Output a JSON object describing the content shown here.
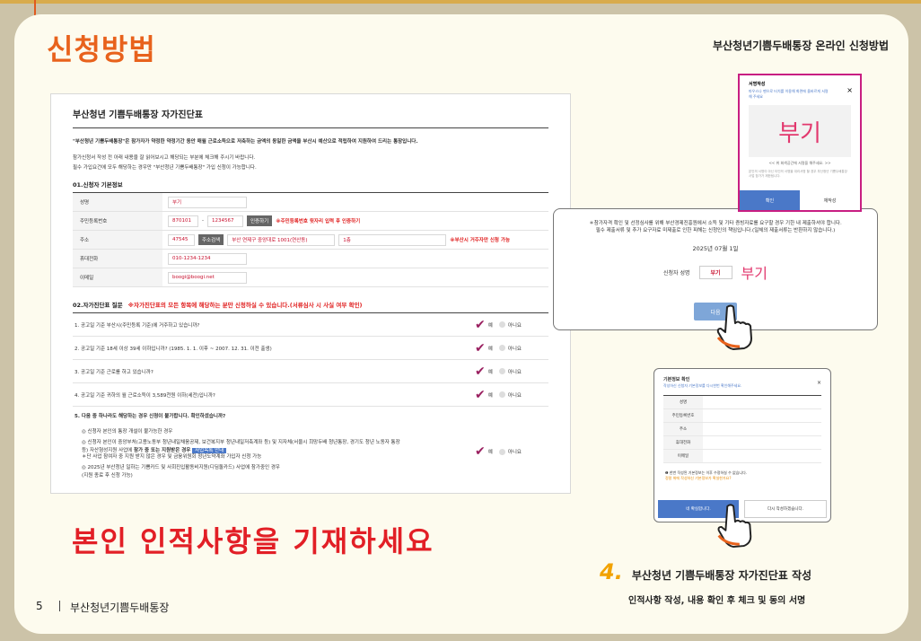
{
  "header": {
    "title": "신청방법",
    "subtitle": "부산청년기쁨두배통장 온라인 신청방법"
  },
  "form": {
    "title": "부산청년 기쁨두배통장 자가진단표",
    "intro_bold": "\"부산청년 기쁨두배통장\"은 참가자가 약정한 약정기간 동안 매월 근로소득으로 저축하는 금액의 동일한 금액을 부산시 예산으로 적립하여 지원하여 드리는 통장입니다.",
    "intro_line1": "참가신청서 작성 전 아래 내용을 잘 읽어보시고 해당되는 부분에 체크해 주시기 바랍니다.",
    "intro_line2": "필수 가입요건에 모두 해당하는 경우만 \"부산청년 기쁨두배통장\" 가입 신청이 가능합니다.",
    "section1": "01.신청자 기본정보",
    "fields": {
      "name_label": "성명",
      "name_value": "부기",
      "rrn_label": "주민등록번호",
      "rrn_front": "870101",
      "rrn_dash": "-",
      "rrn_back": "1234567",
      "verify_btn": "인증하기",
      "rrn_note": "※주민등록번호 뒷자리 입력 후 인증하기",
      "addr_label": "주소",
      "zip": "47545",
      "zip_btn": "주소검색",
      "addr_value": "부산 연제구 중앙대로 1001(연산동)",
      "addr_detail": "1층",
      "addr_note": "※부산시 거주자만 신청 가능",
      "phone_label": "휴대전화",
      "phone_value": "010-1234-1234",
      "email_label": "이메일",
      "email_value": "boogi@boogi.net"
    },
    "section2": "02.자가진단표 질문",
    "section2_note": "※자가진단표의 모든 항목에 해당하는 분만 신청하실 수 있습니다.(서류심사 시 사실 여부 확인)",
    "yes": "예",
    "no": "아니요",
    "questions": [
      "1. 공고일 기준 부산시(주민등록 기준)에 거주하고 있습니까?",
      "2. 공고일 기준 18세 이상 39세 이하입니까? (1985. 1. 1. 이후 ~ 2007. 12. 31. 이전 출생)",
      "3. 공고일 기준 근로를 하고 있습니까?",
      "4. 공고일 기준 귀하의 월 근로소득이 3,589천원 이하(세전)입니까?"
    ],
    "q5": {
      "title": "5. 다음 중 하나라도 해당하는 경우 신청이 불가합니다. 확인하셨습니까?",
      "item1": "◎ 신청자 본인의 통장 개설이 불가능한 경우",
      "item2a": "◎ 신청자 본인이 중앙부처(고용노동부 청년내일채움공제, 보건복지부 청년내일저축계좌 등) 및 지자체(서울시 희망두배 청년통장, 경기도 청년 노동자 통장",
      "item2b_pre": "등) 자산형성지원 사업에",
      "item2b_bold": "참가 중 또는 지원받은 경우",
      "item2b_badge": "사업목록 안내",
      "item2c": "＊단 사업 참여자 중 지원 받지 않은 경우 및 금융위원회 청년도약계좌 가입자 신청 가능",
      "item3a": "◎ 2025년 부산청년 일하는 기쁨카드 및 사회진입활동비지원(디딤돌카드) 사업에 참가중인 경우",
      "item3b": "(지원 종료 후 신청 가능)"
    }
  },
  "caption": "본인 인적사항을 기재하세요",
  "sign_popup": {
    "title": "서명작성",
    "desc": "마우스나 펜으로 터치를 이용해 화면에 올바르게 서명해 주세요",
    "close": "×",
    "signature": "부기",
    "hint": "<< 위 회색공간에 서명을 해주세요. >>",
    "hint2": "본인의 서명이 아닌 타인의 서명을 대리서명 할 경우 부산청년 기쁨두배통장 사업 참가가 제한됩니다.",
    "ok": "확인",
    "rewrite": "재작성"
  },
  "consent": {
    "text1": "＊참가자격 확인 및 선정심사를 위해 부산경제진흥원에서 소득 및 기타 증빙자료를 요구할 경우 기한 내 제출하셔야 합니다.",
    "text2": "필수 제출서류 및 추가 요구자료 미제출로 인한 피해는 신청인의 책임입니다.(일체의 제출서류는 반환하지 않습니다.)",
    "date": "2025년 07월 1일",
    "signer_label": "신청자 성명",
    "signer_name": "부기",
    "handwritten": "부기",
    "next_btn": "다음"
  },
  "info_popup": {
    "title": "기본정보 확인",
    "desc": "작성하신 신청자 기본정보를 다시한번 확인해주세요.",
    "close": "×",
    "rows": [
      "성명",
      "주민등록번호",
      "주소",
      "휴대전화",
      "이메일"
    ],
    "note1": "❶ 한번 작성된 기본정보는 이후 수정하실 수 없습니다.",
    "note2": "정말 위에 작성하신 기본정보가 확실한가요?",
    "ok": "네 확실합니다.",
    "rewrite": "다시 작성하겠습니다."
  },
  "step": {
    "number": "4.",
    "title": "부산청년 기쁨두배통장 자가진단표 작성",
    "desc": "인적사항 작성, 내용 확인 후 체크 및 동의 서명"
  },
  "footer": {
    "page": "5",
    "name": "부산청년기쁨두배통장"
  }
}
